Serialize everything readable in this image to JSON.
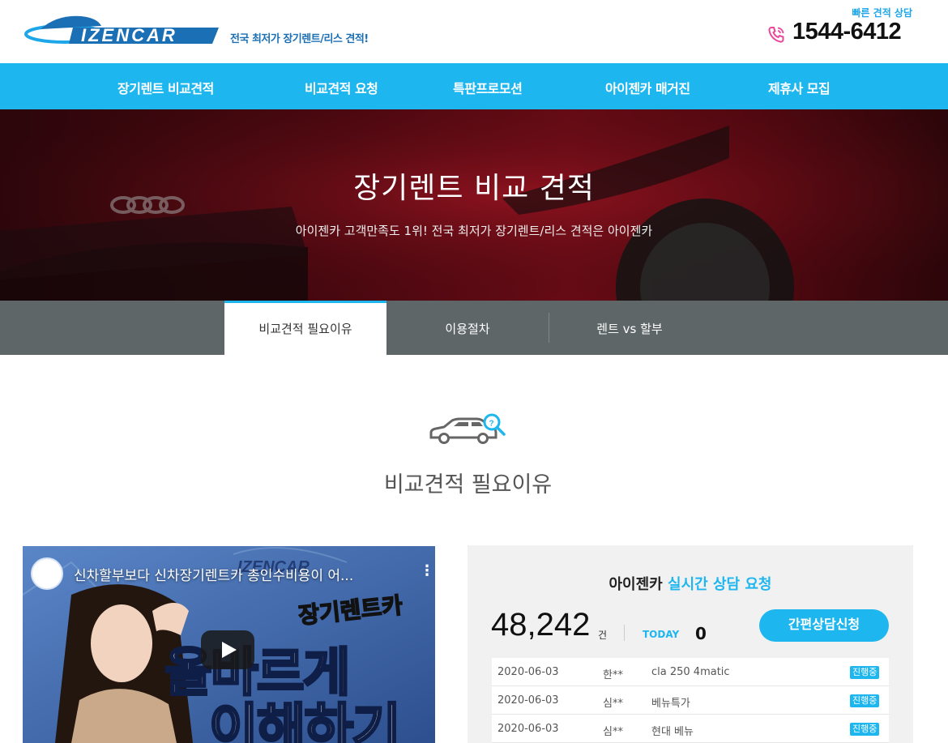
{
  "header": {
    "logo_text": "IZENCAR",
    "tagline": "전국 최저가 장기렌트/리스 견적!",
    "quick_label": "빠른 견적 상담",
    "phone": "1544-6412"
  },
  "nav": {
    "items": [
      {
        "label": "장기렌트 비교견적"
      },
      {
        "label": "비교견적 요청"
      },
      {
        "label": "특판프로모션"
      },
      {
        "label": "아이젠카 매거진"
      },
      {
        "label": "제휴사 모집"
      }
    ]
  },
  "hero": {
    "title": "장기렌트 비교 견적",
    "subtitle": "아이젠카 고객만족도 1위! 전국 최저가 장기렌트/리스 견적은 아이젠카"
  },
  "tabs": [
    {
      "label": "비교견적 필요이유"
    },
    {
      "label": "이용절차"
    },
    {
      "label": "렌트 vs 할부"
    }
  ],
  "section": {
    "title": "비교견적 필요이유"
  },
  "video": {
    "title": "신차할부보다 신차장기렌트카 총인수비용이 어...",
    "logo_text": "IZENCAR",
    "script_text": "장기렌트카",
    "caption_line1": "올바르게",
    "caption_line2": "이해하기"
  },
  "consult": {
    "title_prefix": "아이젠카",
    "title_highlight": "실시간 상담 요청",
    "total_count": "48,242",
    "count_unit": "건",
    "today_label": "TODAY",
    "today_value": "0",
    "apply_button": "간편상담신청",
    "rows": [
      {
        "date": "2020-06-03",
        "name": "한**",
        "car": "cla 250 4matic",
        "status": "진행중"
      },
      {
        "date": "2020-06-03",
        "name": "심**",
        "car": "베뉴특가",
        "status": "진행중"
      },
      {
        "date": "2020-06-03",
        "name": "심**",
        "car": "현대 베뉴",
        "status": "진행중"
      }
    ]
  },
  "colors": {
    "accent": "#1eb6ef",
    "tab_bar": "#5f6667",
    "brand_blue": "#1b6fb4",
    "phone_icon": "#e8479a"
  }
}
